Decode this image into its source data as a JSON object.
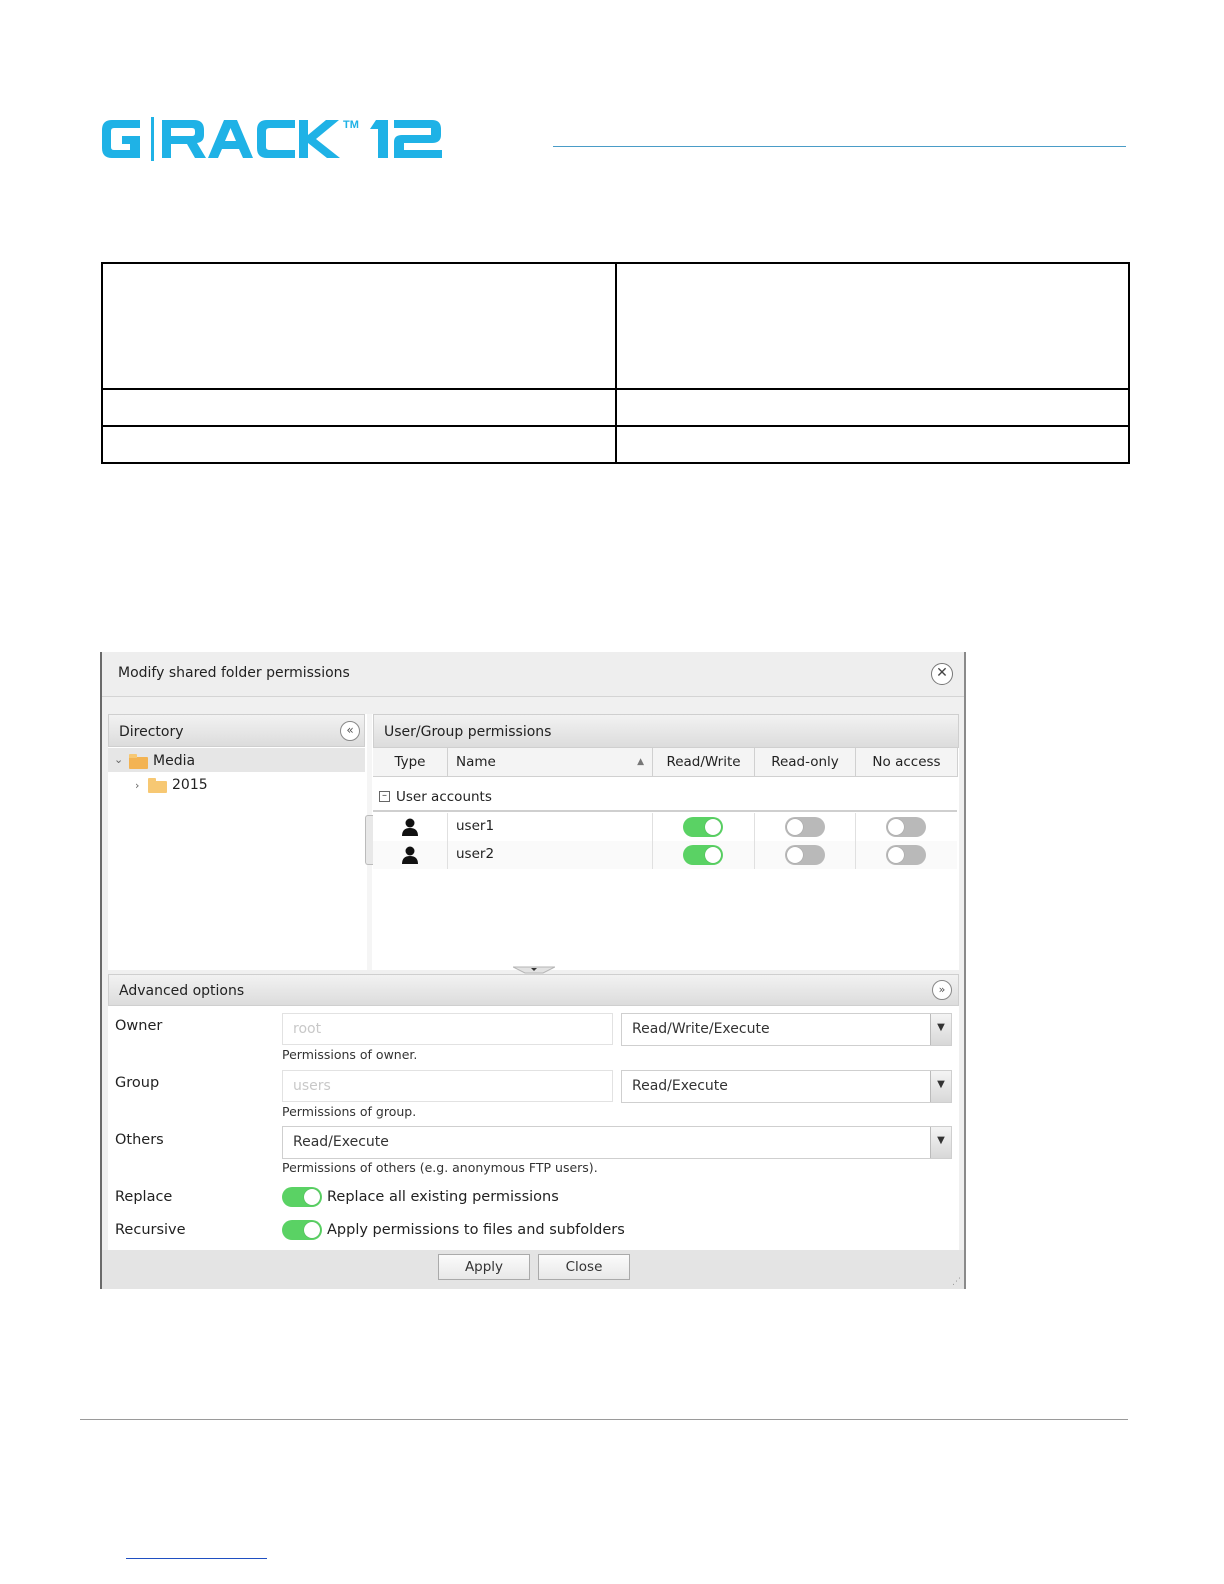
{
  "header": {
    "logo_text": "G|RACK 12",
    "logo_mark": "TM",
    "brand_color": "#1fb2e6"
  },
  "dialog": {
    "title": "Modify shared folder permissions",
    "directory": {
      "title": "Directory",
      "tree": [
        {
          "label": "Media",
          "expanded": true,
          "selected": true
        },
        {
          "label": "2015",
          "expanded": false,
          "selected": false
        }
      ]
    },
    "permissions": {
      "title": "User/Group permissions",
      "columns": [
        "Type",
        "Name",
        "Read/Write",
        "Read-only",
        "No access"
      ],
      "group_label": "User accounts",
      "rows": [
        {
          "type_icon": "user-icon",
          "name": "user1",
          "read_write": true,
          "read_only": false,
          "no_access": false
        },
        {
          "type_icon": "user-icon",
          "name": "user2",
          "read_write": true,
          "read_only": false,
          "no_access": false
        }
      ]
    },
    "advanced": {
      "title": "Advanced options",
      "owner": {
        "label": "Owner",
        "placeholder": "root",
        "selected": "Read/Write/Execute",
        "hint": "Permissions of owner."
      },
      "group": {
        "label": "Group",
        "placeholder": "users",
        "selected": "Read/Execute",
        "hint": "Permissions of group."
      },
      "others": {
        "label": "Others",
        "selected": "Read/Execute",
        "hint": "Permissions of others (e.g. anonymous FTP users)."
      },
      "replace": {
        "label": "Replace",
        "enabled": true,
        "text": "Replace all existing permissions"
      },
      "recursive": {
        "label": "Recursive",
        "enabled": true,
        "text": "Apply permissions to files and subfolders"
      }
    },
    "buttons": {
      "apply": "Apply",
      "close": "Close"
    }
  },
  "colors": {
    "switch_on": "#5ad264",
    "switch_off": "#b9b9b9",
    "header_rule": "#4a9cc7"
  }
}
